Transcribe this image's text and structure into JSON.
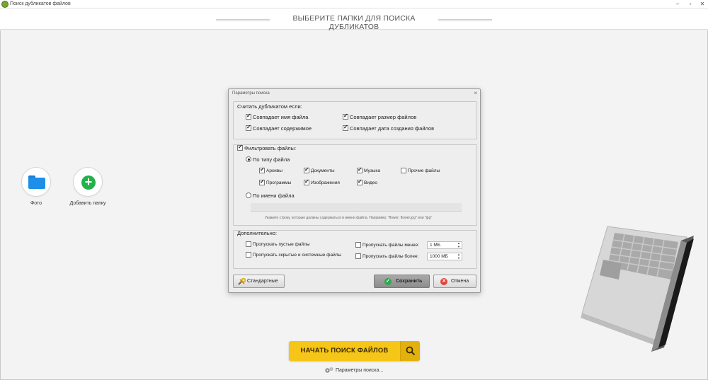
{
  "window": {
    "title": "Поиск дубликатов файлов",
    "minimize": "–",
    "maximize": "▫",
    "close": "✕"
  },
  "header": {
    "title": "ВЫБЕРИТЕ ПАПКИ ДЛЯ ПОИСКА ДУБЛИКАТОВ"
  },
  "folders": [
    {
      "label": "Фото",
      "icon": "folder-icon"
    },
    {
      "label": "Добавить папку",
      "icon": "add-icon"
    }
  ],
  "dialog": {
    "title": "Параметры поиска",
    "close": "×",
    "duplicates_group": {
      "title": "Считать дубликатом если:",
      "options": [
        {
          "label": "Совпадает имя файла",
          "checked": true
        },
        {
          "label": "Совпадает размер файлов",
          "checked": true
        },
        {
          "label": "Совпадает содержимое",
          "checked": true
        },
        {
          "label": "Совпадает дата создания файлов",
          "checked": true
        }
      ]
    },
    "filter_group": {
      "title": "Фильтровать файлы:",
      "checked": true,
      "by_type": {
        "label": "По типу файла",
        "selected": true
      },
      "types": [
        {
          "label": "Архивы",
          "checked": true
        },
        {
          "label": "Документы",
          "checked": true
        },
        {
          "label": "Музыка",
          "checked": true
        },
        {
          "label": "Прочие файлы",
          "checked": false
        },
        {
          "label": "Программы",
          "checked": true
        },
        {
          "label": "Изображения",
          "checked": true
        },
        {
          "label": "Видео",
          "checked": true
        }
      ],
      "by_name": {
        "label": "По имени файла",
        "selected": false
      },
      "name_value": "",
      "hint": "Укажите строку, которые должны содержаться в имени файла. Например: \"flower; flower.jpg\" или \"jpg\""
    },
    "extra_group": {
      "title": "Дополнительно:",
      "options": [
        {
          "label": "Пропускать пустые файлы",
          "checked": false
        },
        {
          "label": "Пропускать скрытые и системные файлы",
          "checked": false
        }
      ],
      "size_less": {
        "label": "Пропускать файлы менее:",
        "checked": false,
        "value": "1 МБ"
      },
      "size_more": {
        "label": "Пропускать файлы более:",
        "checked": false,
        "value": "1000 МБ"
      }
    },
    "buttons": {
      "defaults": "Стандартные",
      "save": "Сохранить",
      "cancel": "Отмена"
    }
  },
  "start_button": "НАЧАТЬ ПОИСК ФАЙЛОВ",
  "params_link": "Параметры поиска...",
  "colors": {
    "accent": "#f5c518",
    "folder": "#1e8fe8",
    "add": "#23b24a",
    "save_icon": "#2fa84f",
    "cancel_icon": "#e0443a"
  }
}
